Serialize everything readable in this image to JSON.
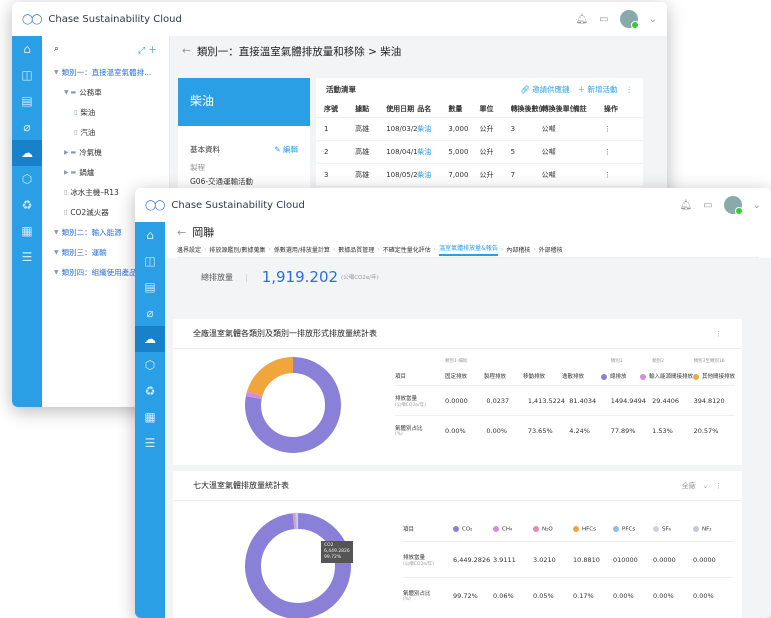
{
  "app_title": "Chase Sustainability Cloud",
  "back_window": {
    "page_title": "類別一：直接溫室氣體排放量和移除 > 柴油",
    "tree": [
      {
        "label": "類別一：直接溫室氣體排...",
        "level": 0,
        "icon": "▼"
      },
      {
        "label": "公務車",
        "level": 1,
        "icon": "▼ ▬"
      },
      {
        "label": "柴油",
        "level": 2,
        "icon": "▯"
      },
      {
        "label": "汽油",
        "level": 2,
        "icon": "▯"
      },
      {
        "label": "冷氣機",
        "level": 1,
        "icon": "▶ ▬"
      },
      {
        "label": "鍋爐",
        "level": 1,
        "icon": "▶ ▬"
      },
      {
        "label": "冰水主機–R13",
        "level": 1,
        "icon": "▯"
      },
      {
        "label": "CO2滅火器",
        "level": 1,
        "icon": "▯"
      },
      {
        "label": "類別二：輸入能源",
        "level": 0,
        "icon": "▼"
      },
      {
        "label": "類別三：運輸",
        "level": 0,
        "icon": "▼"
      },
      {
        "label": "類別四：組織使用產品",
        "level": 0,
        "icon": "▼"
      }
    ],
    "card_title": "柴油",
    "basic_info": "基本資料",
    "edit": "編輯",
    "process_label": "製程",
    "process_value": "G06-交通運輸活動",
    "list_title": "活動清單",
    "invite": "邀請供應鏈",
    "add_activity": "新增活動",
    "columns": [
      "序號",
      "據點",
      "使用日期",
      "品名",
      "數量",
      "單位",
      "轉換後數值",
      "轉換後單位",
      "備註",
      "操作"
    ],
    "rows": [
      [
        "1",
        "高雄",
        "108/03/23",
        "柴油",
        "3,000",
        "公升",
        "3",
        "公噸",
        "",
        "⋮"
      ],
      [
        "2",
        "高雄",
        "108/04/11",
        "柴油",
        "5,000",
        "公升",
        "5",
        "公噸",
        "",
        "⋮"
      ],
      [
        "3",
        "高雄",
        "108/05/25",
        "柴油",
        "7,000",
        "公升",
        "7",
        "公噸",
        "",
        "⋮"
      ]
    ]
  },
  "front_window": {
    "page_title": "岡聯",
    "steps": [
      "邊界設定",
      "排放源鑑別/數據蒐集",
      "係數選用/排放量計算",
      "數據品質管理",
      "不確定性量化評估",
      "溫室氣體排放量&報告",
      "內部稽核",
      "外部稽核"
    ],
    "active_step": 5,
    "total_label": "總排放量",
    "total_value": "1,919.202",
    "total_unit": "(公噸CO2e/年)",
    "section1": {
      "title": "全廠溫室氣體各類別及類別一排放形式排放量統計表",
      "group_labels": [
        "類別1-細則",
        "類別1",
        "類別2",
        "類別3至類別16"
      ],
      "headers": [
        "項目",
        "固定排放",
        "製程排放",
        "移動排放",
        "逸散排放",
        "總排放",
        "輸入能源間接排放",
        "其他間接排放"
      ],
      "row1_label": "排放當量",
      "row1_unit": "(公噸CO2e/年)",
      "row1": [
        "0.0000",
        "0.0237",
        "1,413.5224",
        "81.4034",
        "1494.9494",
        "29.4406",
        "394.8120"
      ],
      "row2_label": "氣體別占比",
      "row2_unit": "(%)",
      "row2": [
        "0.00%",
        "0.00%",
        "73.65%",
        "4.24%",
        "77.89%",
        "1.53%",
        "20.57%"
      ],
      "colors": {
        "total": "#8a80d8",
        "energy": "#d58be0",
        "other": "#f1a63d"
      }
    },
    "section2": {
      "title": "七大溫室氣體排放量統計表",
      "filter": "全廠",
      "headers": [
        "項目",
        "CO₂",
        "CH₄",
        "N₂O",
        "HFCs",
        "PFCs",
        "SF₆",
        "NF₃"
      ],
      "gas_colors": [
        "#8a80d8",
        "#d58be0",
        "#e48ab8",
        "#f1a63d",
        "#86c0f0",
        "#cfd4dc",
        "#c4c9d2"
      ],
      "row1_label": "排放當量",
      "row1_unit": "(公噸CO2e/年)",
      "row1": [
        "6,449.2826",
        "3.9111",
        "3.0210",
        "10.8810",
        "010000",
        "0.0000",
        "0.0000"
      ],
      "row2_label": "氣體別占比",
      "row2_unit": "(%)",
      "row2": [
        "99.72%",
        "0.06%",
        "0.05%",
        "0.17%",
        "0.00%",
        "0.00%",
        "0.00%"
      ],
      "tooltip_title": "CO2",
      "tooltip_value": "6,449.2826",
      "tooltip_pct": "99.72%"
    }
  }
}
